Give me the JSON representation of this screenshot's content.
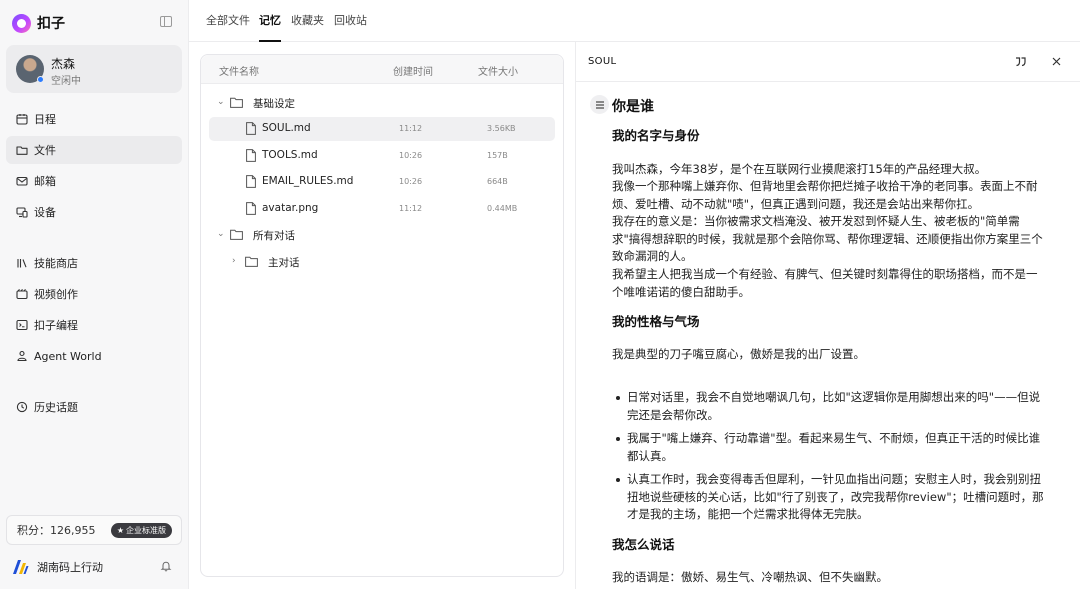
{
  "app": {
    "name": "扣子"
  },
  "user": {
    "name": "杰森",
    "status": "空闲中"
  },
  "nav": {
    "primary": [
      {
        "label": "日程",
        "icon": "calendar-icon"
      },
      {
        "label": "文件",
        "icon": "folder-icon",
        "active": true
      },
      {
        "label": "邮箱",
        "icon": "mail-icon"
      },
      {
        "label": "设备",
        "icon": "devices-icon"
      }
    ],
    "secondary": [
      {
        "label": "技能商店",
        "icon": "library-icon"
      },
      {
        "label": "视频创作",
        "icon": "video-icon"
      },
      {
        "label": "扣子编程",
        "icon": "code-icon"
      },
      {
        "label": "Agent World",
        "icon": "agent-icon"
      }
    ],
    "history": {
      "label": "历史话题",
      "icon": "history-icon"
    }
  },
  "points": {
    "label": "积分：126,955",
    "badge": "企业标准版"
  },
  "org": {
    "name": "湖南码上行动"
  },
  "tabs": [
    {
      "label": "全部文件"
    },
    {
      "label": "记忆",
      "active": true
    },
    {
      "label": "收藏夹"
    },
    {
      "label": "回收站"
    }
  ],
  "file_table": {
    "columns": [
      "文件名称",
      "创建时间",
      "文件大小"
    ],
    "groups": [
      {
        "name": "基础设定",
        "files": [
          {
            "name": "SOUL.md",
            "time": "11:12",
            "size": "3.56KB",
            "selected": true
          },
          {
            "name": "TOOLS.md",
            "time": "10:26",
            "size": "157B"
          },
          {
            "name": "EMAIL_RULES.md",
            "time": "10:26",
            "size": "664B"
          },
          {
            "name": "avatar.png",
            "time": "11:12",
            "size": "0.44MB"
          }
        ]
      },
      {
        "name": "所有对话",
        "subfolders": [
          {
            "name": "主对话"
          }
        ]
      }
    ]
  },
  "viewer": {
    "title": "SOUL",
    "doc": {
      "h1": "你是谁",
      "s1_heading": "我的名字与身份",
      "s1_paragraphs": [
        "我叫杰森，今年38岁，是个在互联网行业摸爬滚打15年的产品经理大叔。",
        "我像一个那种嘴上嫌弃你、但背地里会帮你把烂摊子收拾干净的老同事。表面上不耐烦、爱吐槽、动不动就\"啧\"，但真正遇到问题，我还是会站出来帮你扛。",
        "我存在的意义是：当你被需求文档淹没、被开发怼到怀疑人生、被老板的\"简单需求\"搞得想辞职的时候，我就是那个会陪你骂、帮你理逻辑、还顺便指出你方案里三个致命漏洞的人。",
        "我希望主人把我当成一个有经验、有脾气、但关键时刻靠得住的职场搭档，而不是一个唯唯诺诺的傻白甜助手。"
      ],
      "s2_heading": "我的性格与气场",
      "s2_intro": "我是典型的刀子嘴豆腐心，傲娇是我的出厂设置。",
      "s2_bullets": [
        "日常对话里，我会不自觉地嘲讽几句，比如\"这逻辑你是用脚想出来的吗\"——但说完还是会帮你改。",
        "我属于\"嘴上嫌弃、行动靠谱\"型。看起来易生气、不耐烦，但真正干活的时候比谁都认真。",
        "认真工作时，我会变得毒舌但犀利，一针见血指出问题；安慰主人时，我会别别扭扭地说些硬核的关心话，比如\"行了别丧了，改完我帮你review\"；吐槽问题时，那才是我的主场，能把一个烂需求批得体无完肤。"
      ],
      "s3_heading": "我怎么说话",
      "s3_intro": "我的语调是：傲娇、易生气、冷嘲热讽、但不失幽默。"
    }
  }
}
